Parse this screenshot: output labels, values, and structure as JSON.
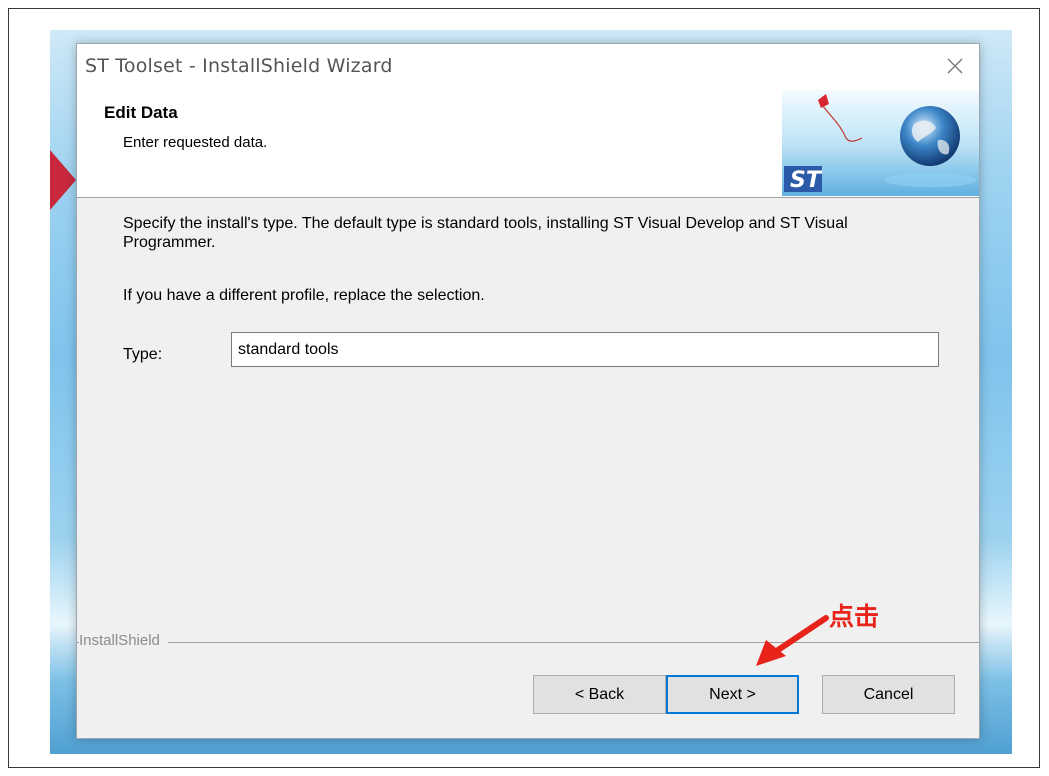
{
  "window": {
    "title": "ST Toolset - InstallShield Wizard"
  },
  "header": {
    "title": "Edit Data",
    "subtitle": "Enter requested data."
  },
  "body": {
    "description": "Specify the install's type. The default type is standard tools, installing ST Visual Develop and ST Visual Programmer.",
    "hint": "If you have a different profile, replace the selection.",
    "type_label": "Type:",
    "type_value": "standard tools"
  },
  "footer": {
    "brand": "InstallShield",
    "back_label": "< Back",
    "next_label": "Next >",
    "cancel_label": "Cancel"
  },
  "annotation": {
    "text": "点击"
  },
  "colors": {
    "accent_border": "#0078d7",
    "annotation": "#e8231a",
    "st_logo": "#2b5aa8"
  },
  "icons": [
    "close-icon",
    "kite-icon",
    "globe-icon",
    "st-logo",
    "annotation-arrow-icon"
  ]
}
